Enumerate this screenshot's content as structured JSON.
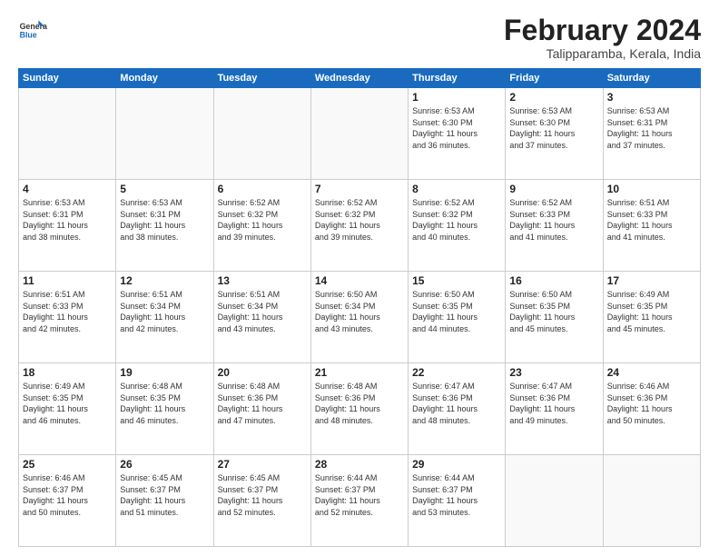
{
  "header": {
    "logo_line1": "General",
    "logo_line2": "Blue",
    "month_title": "February 2024",
    "subtitle": "Talipparamba, Kerala, India"
  },
  "days_of_week": [
    "Sunday",
    "Monday",
    "Tuesday",
    "Wednesday",
    "Thursday",
    "Friday",
    "Saturday"
  ],
  "weeks": [
    [
      {
        "day": "",
        "info": ""
      },
      {
        "day": "",
        "info": ""
      },
      {
        "day": "",
        "info": ""
      },
      {
        "day": "",
        "info": ""
      },
      {
        "day": "1",
        "info": "Sunrise: 6:53 AM\nSunset: 6:30 PM\nDaylight: 11 hours\nand 36 minutes."
      },
      {
        "day": "2",
        "info": "Sunrise: 6:53 AM\nSunset: 6:30 PM\nDaylight: 11 hours\nand 37 minutes."
      },
      {
        "day": "3",
        "info": "Sunrise: 6:53 AM\nSunset: 6:31 PM\nDaylight: 11 hours\nand 37 minutes."
      }
    ],
    [
      {
        "day": "4",
        "info": "Sunrise: 6:53 AM\nSunset: 6:31 PM\nDaylight: 11 hours\nand 38 minutes."
      },
      {
        "day": "5",
        "info": "Sunrise: 6:53 AM\nSunset: 6:31 PM\nDaylight: 11 hours\nand 38 minutes."
      },
      {
        "day": "6",
        "info": "Sunrise: 6:52 AM\nSunset: 6:32 PM\nDaylight: 11 hours\nand 39 minutes."
      },
      {
        "day": "7",
        "info": "Sunrise: 6:52 AM\nSunset: 6:32 PM\nDaylight: 11 hours\nand 39 minutes."
      },
      {
        "day": "8",
        "info": "Sunrise: 6:52 AM\nSunset: 6:32 PM\nDaylight: 11 hours\nand 40 minutes."
      },
      {
        "day": "9",
        "info": "Sunrise: 6:52 AM\nSunset: 6:33 PM\nDaylight: 11 hours\nand 41 minutes."
      },
      {
        "day": "10",
        "info": "Sunrise: 6:51 AM\nSunset: 6:33 PM\nDaylight: 11 hours\nand 41 minutes."
      }
    ],
    [
      {
        "day": "11",
        "info": "Sunrise: 6:51 AM\nSunset: 6:33 PM\nDaylight: 11 hours\nand 42 minutes."
      },
      {
        "day": "12",
        "info": "Sunrise: 6:51 AM\nSunset: 6:34 PM\nDaylight: 11 hours\nand 42 minutes."
      },
      {
        "day": "13",
        "info": "Sunrise: 6:51 AM\nSunset: 6:34 PM\nDaylight: 11 hours\nand 43 minutes."
      },
      {
        "day": "14",
        "info": "Sunrise: 6:50 AM\nSunset: 6:34 PM\nDaylight: 11 hours\nand 43 minutes."
      },
      {
        "day": "15",
        "info": "Sunrise: 6:50 AM\nSunset: 6:35 PM\nDaylight: 11 hours\nand 44 minutes."
      },
      {
        "day": "16",
        "info": "Sunrise: 6:50 AM\nSunset: 6:35 PM\nDaylight: 11 hours\nand 45 minutes."
      },
      {
        "day": "17",
        "info": "Sunrise: 6:49 AM\nSunset: 6:35 PM\nDaylight: 11 hours\nand 45 minutes."
      }
    ],
    [
      {
        "day": "18",
        "info": "Sunrise: 6:49 AM\nSunset: 6:35 PM\nDaylight: 11 hours\nand 46 minutes."
      },
      {
        "day": "19",
        "info": "Sunrise: 6:48 AM\nSunset: 6:35 PM\nDaylight: 11 hours\nand 46 minutes."
      },
      {
        "day": "20",
        "info": "Sunrise: 6:48 AM\nSunset: 6:36 PM\nDaylight: 11 hours\nand 47 minutes."
      },
      {
        "day": "21",
        "info": "Sunrise: 6:48 AM\nSunset: 6:36 PM\nDaylight: 11 hours\nand 48 minutes."
      },
      {
        "day": "22",
        "info": "Sunrise: 6:47 AM\nSunset: 6:36 PM\nDaylight: 11 hours\nand 48 minutes."
      },
      {
        "day": "23",
        "info": "Sunrise: 6:47 AM\nSunset: 6:36 PM\nDaylight: 11 hours\nand 49 minutes."
      },
      {
        "day": "24",
        "info": "Sunrise: 6:46 AM\nSunset: 6:36 PM\nDaylight: 11 hours\nand 50 minutes."
      }
    ],
    [
      {
        "day": "25",
        "info": "Sunrise: 6:46 AM\nSunset: 6:37 PM\nDaylight: 11 hours\nand 50 minutes."
      },
      {
        "day": "26",
        "info": "Sunrise: 6:45 AM\nSunset: 6:37 PM\nDaylight: 11 hours\nand 51 minutes."
      },
      {
        "day": "27",
        "info": "Sunrise: 6:45 AM\nSunset: 6:37 PM\nDaylight: 11 hours\nand 52 minutes."
      },
      {
        "day": "28",
        "info": "Sunrise: 6:44 AM\nSunset: 6:37 PM\nDaylight: 11 hours\nand 52 minutes."
      },
      {
        "day": "29",
        "info": "Sunrise: 6:44 AM\nSunset: 6:37 PM\nDaylight: 11 hours\nand 53 minutes."
      },
      {
        "day": "",
        "info": ""
      },
      {
        "day": "",
        "info": ""
      }
    ]
  ]
}
